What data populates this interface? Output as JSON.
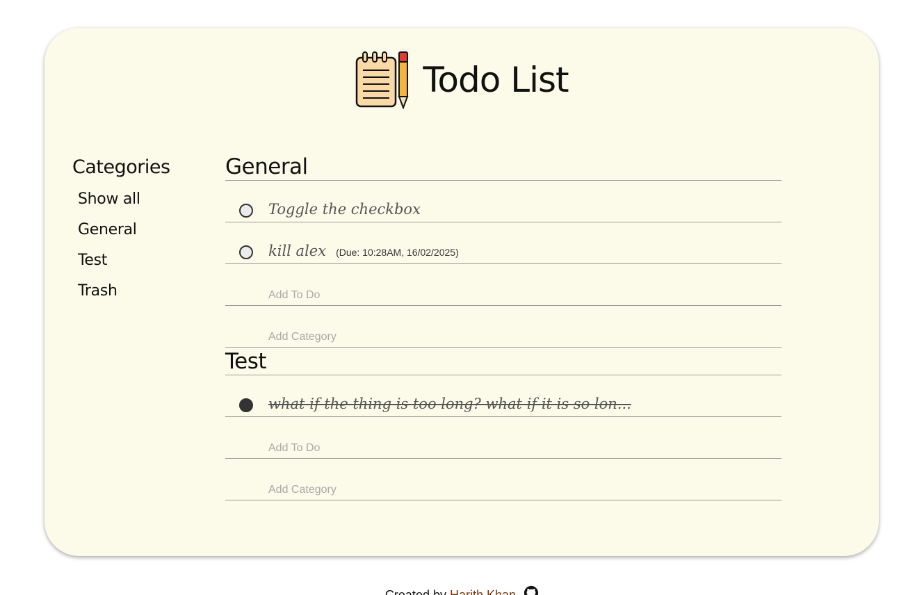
{
  "header": {
    "title": "Todo List",
    "logo_icon": "notepad-pencil-icon"
  },
  "sidebar": {
    "heading": "Categories",
    "items": [
      {
        "label": "Show all"
      },
      {
        "label": "General"
      },
      {
        "label": "Test"
      },
      {
        "label": "Trash"
      }
    ]
  },
  "sections": [
    {
      "title": "General",
      "todos": [
        {
          "text": "Toggle the checkbox",
          "done": false,
          "due": ""
        },
        {
          "text": "kill alex",
          "done": false,
          "due": "(Due: 10:28AM, 16/02/2025)"
        }
      ],
      "add_todo_placeholder": "Add To Do",
      "add_category_placeholder": "Add Category"
    },
    {
      "title": "Test",
      "todos": [
        {
          "text": "what if the thing is too long? what if it is so lon...",
          "done": true,
          "due": ""
        }
      ],
      "add_todo_placeholder": "Add To Do",
      "add_category_placeholder": "Add Category"
    }
  ],
  "footer": {
    "prefix": "Created by",
    "author": "Harith Khan",
    "icon": "github-icon"
  },
  "colors": {
    "card_bg": "#fcfbe9",
    "link": "#7a3b12",
    "divider": "#9a9a9a"
  }
}
